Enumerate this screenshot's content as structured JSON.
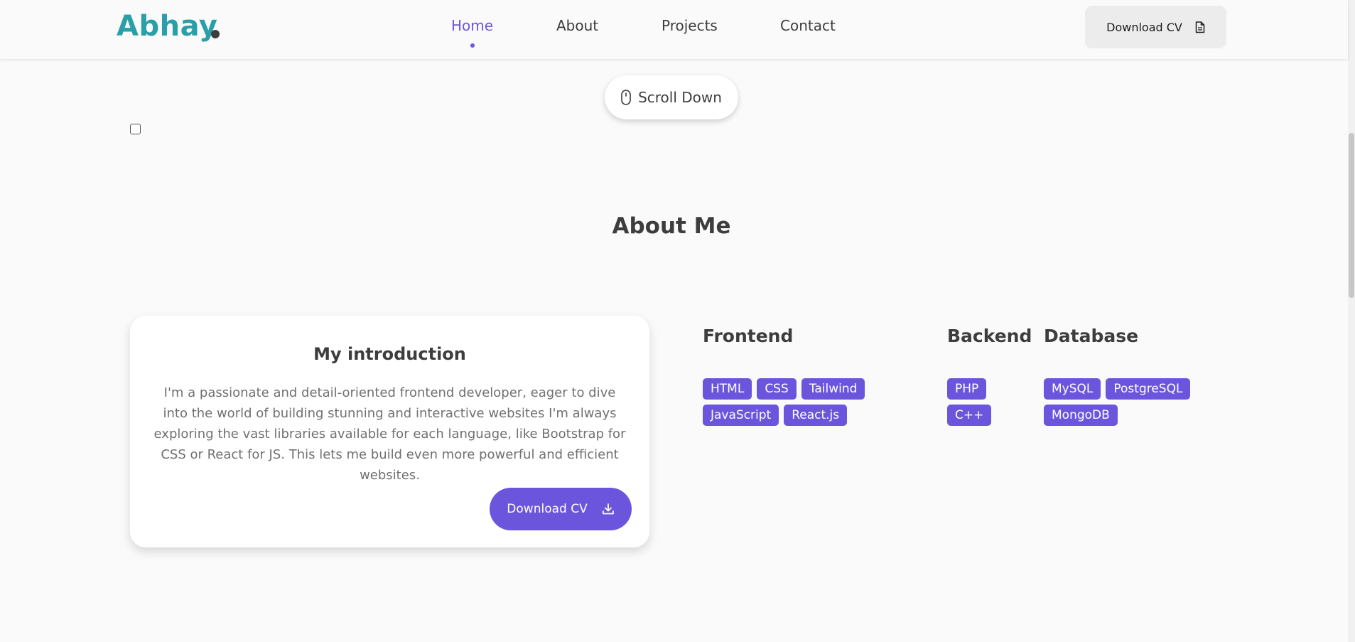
{
  "header": {
    "logo": "Abhay",
    "nav": [
      {
        "label": "Home",
        "active": true
      },
      {
        "label": "About",
        "active": false
      },
      {
        "label": "Projects",
        "active": false
      },
      {
        "label": "Contact",
        "active": false
      }
    ],
    "download_label": "Download CV",
    "download_icon": "document-icon"
  },
  "scroll": {
    "label": "Scroll Down",
    "icon": "mouse-icon"
  },
  "about": {
    "title": "About Me",
    "card": {
      "title": "My introduction",
      "text": "I'm a passionate and detail-oriented frontend developer, eager to dive into the world of building stunning and interactive websites I'm always exploring the vast libraries available for each language, like Bootstrap for CSS or React for JS. This lets me build even more powerful and efficient websites.",
      "button_label": "Download CV",
      "button_icon": "download-icon"
    },
    "skills": [
      {
        "heading": "Frontend",
        "tags": [
          "HTML",
          "CSS",
          "Tailwind",
          "JavaScript",
          "React.js"
        ]
      },
      {
        "heading": "Backend",
        "tags": [
          "PHP",
          "C++"
        ]
      },
      {
        "heading": "Database",
        "tags": [
          "MySQL",
          "PostgreSQL",
          "MongoDB"
        ]
      }
    ]
  },
  "colors": {
    "accent": "#6c55dd",
    "logo": "#2a9fa8",
    "background": "#fafafa",
    "text": "#3d3d3d"
  }
}
